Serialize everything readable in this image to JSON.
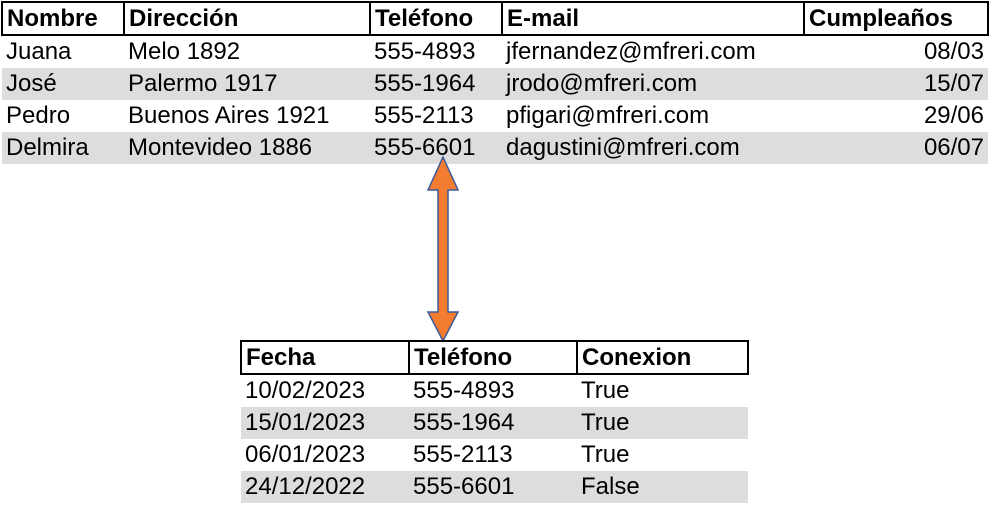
{
  "contacts": {
    "headers": [
      "Nombre",
      "Dirección",
      "Teléfono",
      "E-mail",
      "Cumpleaños"
    ],
    "rows": [
      [
        "Juana",
        "Melo 1892",
        "555-4893",
        "jfernandez@mfreri.com",
        "08/03"
      ],
      [
        "José",
        "Palermo 1917",
        "555-1964",
        "jrodo@mfreri.com",
        "15/07"
      ],
      [
        "Pedro",
        "Buenos Aires 1921",
        "555-2113",
        "pfigari@mfreri.com",
        "29/06"
      ],
      [
        "Delmira",
        "Montevideo 1886",
        "555-6601",
        "dagustini@mfreri.com",
        "06/07"
      ]
    ]
  },
  "calls": {
    "headers": [
      "Fecha",
      "Teléfono",
      "Conexion"
    ],
    "rows": [
      [
        "10/02/2023",
        "555-4893",
        "True"
      ],
      [
        "15/01/2023",
        "555-1964",
        "True"
      ],
      [
        "06/01/2023",
        "555-2113",
        "True"
      ],
      [
        "24/12/2022",
        "555-6601",
        "False"
      ]
    ]
  },
  "colors": {
    "arrow_fill": "#f47c30",
    "arrow_stroke": "#3b5a9a",
    "row_shade": "#dddddd"
  },
  "icons": {
    "link": "double-headed-arrow-icon"
  }
}
